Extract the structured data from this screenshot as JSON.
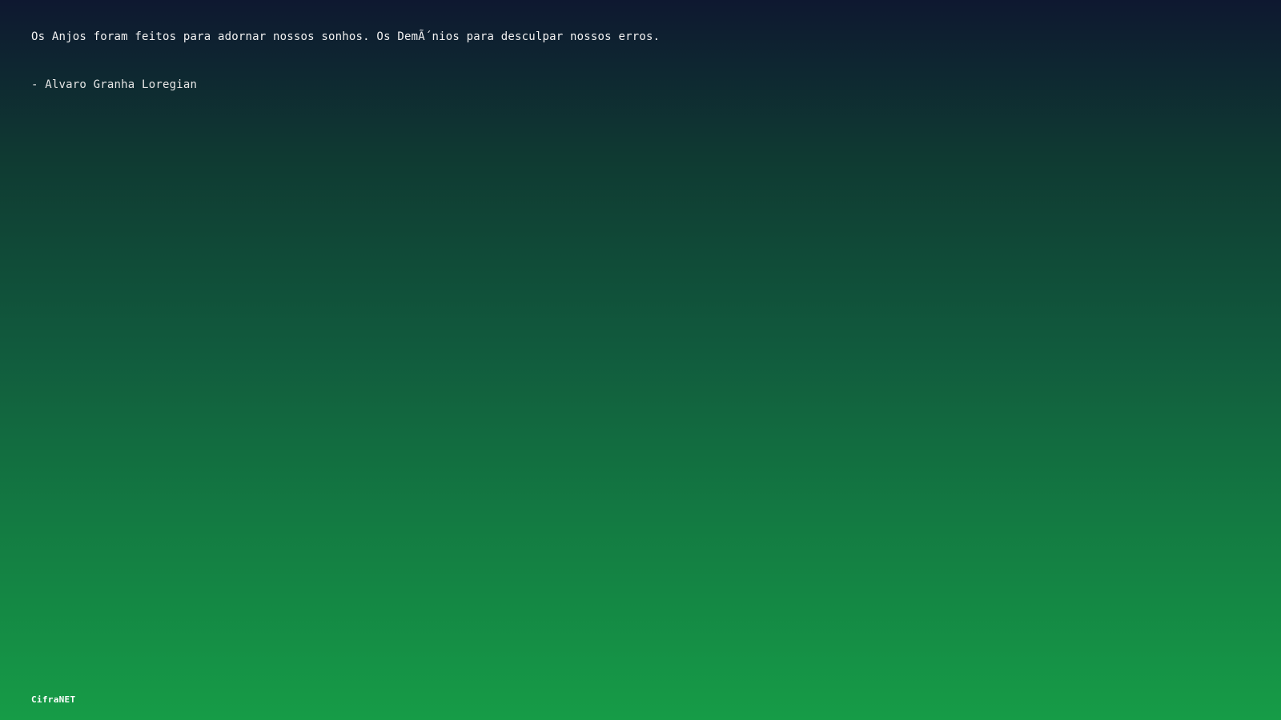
{
  "quote": {
    "text": "Os Anjos foram feitos para adornar nossos sonhos. Os DemÃ´nios para desculpar nossos erros.",
    "author": "- Alvaro Granha Loregian"
  },
  "footer": {
    "brand": "CifraNET"
  },
  "colors": {
    "gradient_top": "#0e1830",
    "gradient_bottom": "#169c47",
    "text": "#f2f2f2"
  }
}
